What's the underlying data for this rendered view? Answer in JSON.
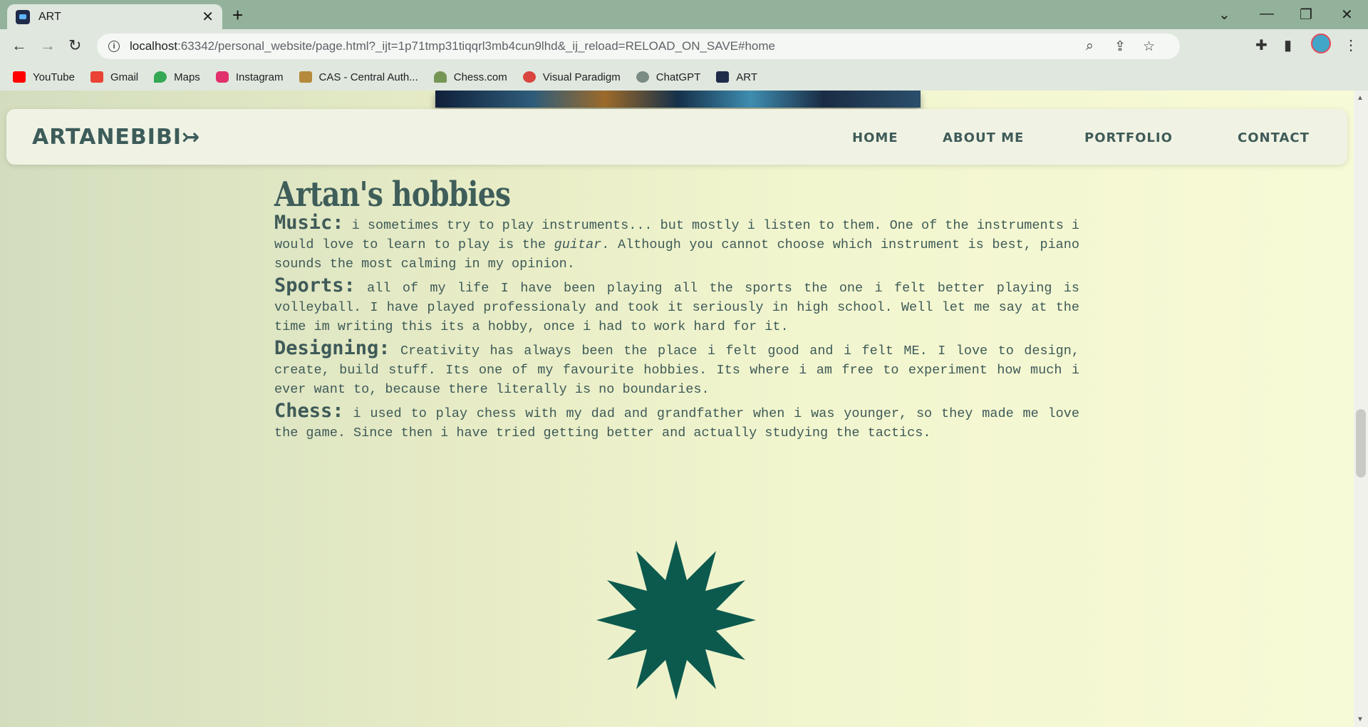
{
  "browser": {
    "tab_title": "ART",
    "tab_close": "✕",
    "new_tab": "+",
    "url_host": "localhost",
    "url_path": ":63342/personal_website/page.html?_ijt=1p71tmp31tiqqrl3mb4cun9lhd&_ij_reload=RELOAD_ON_SAVE#home",
    "bookmarks": [
      {
        "label": "YouTube",
        "color": "#ff0000"
      },
      {
        "label": "Gmail",
        "color": "#ea4335"
      },
      {
        "label": "Maps",
        "color": "#34a853"
      },
      {
        "label": "Instagram",
        "color": "#e1306c"
      },
      {
        "label": "CAS - Central Auth...",
        "color": "#b58a3c"
      },
      {
        "label": "Chess.com",
        "color": "#769656"
      },
      {
        "label": "Visual Paradigm",
        "color": "#d9443f"
      },
      {
        "label": "ChatGPT",
        "color": "#7a8c84"
      },
      {
        "label": "ART",
        "color": "#1f2b4a"
      }
    ]
  },
  "site": {
    "logo": "ARTANEBIBI↣",
    "nav": {
      "home": "HOME",
      "about": "ABOUT ME",
      "portfolio": "PORTFOLIO",
      "contact": "CONTACT"
    },
    "hobbies_title": "Artan's hobbies",
    "hobbies": {
      "music_label": "Music:",
      "music_text_a": " i sometimes try to play instruments... but mostly i listen to them. One of the instruments i would love to learn to play is the ",
      "music_em": "guitar",
      "music_text_b": ". Although you cannot choose which instrument is best, piano sounds the most calming in my opinion.",
      "sports_label": "Sports:",
      "sports_text": " all of my life I have been playing all the sports the one i felt better playing is volleyball. I have played professionaly and took it seriously in high school. Well let me say at the time im writing this its a hobby, once i had to work hard for it.",
      "designing_label": "Designing:",
      "designing_text": " Creativity has always been the place i felt good and i felt ME. I love to design, create, build stuff. Its one of my favourite hobbies. Its where i am free to experiment how much i ever want to, because there literally is no boundaries.",
      "chess_label": "Chess:",
      "chess_text": " i used to play chess with my dad and grandfather when i was younger, so they made me love the game. Since then i have tried getting better and actually studying the tactics."
    },
    "colors": {
      "accent": "#0c5a4e",
      "text": "#3e5a58"
    }
  }
}
